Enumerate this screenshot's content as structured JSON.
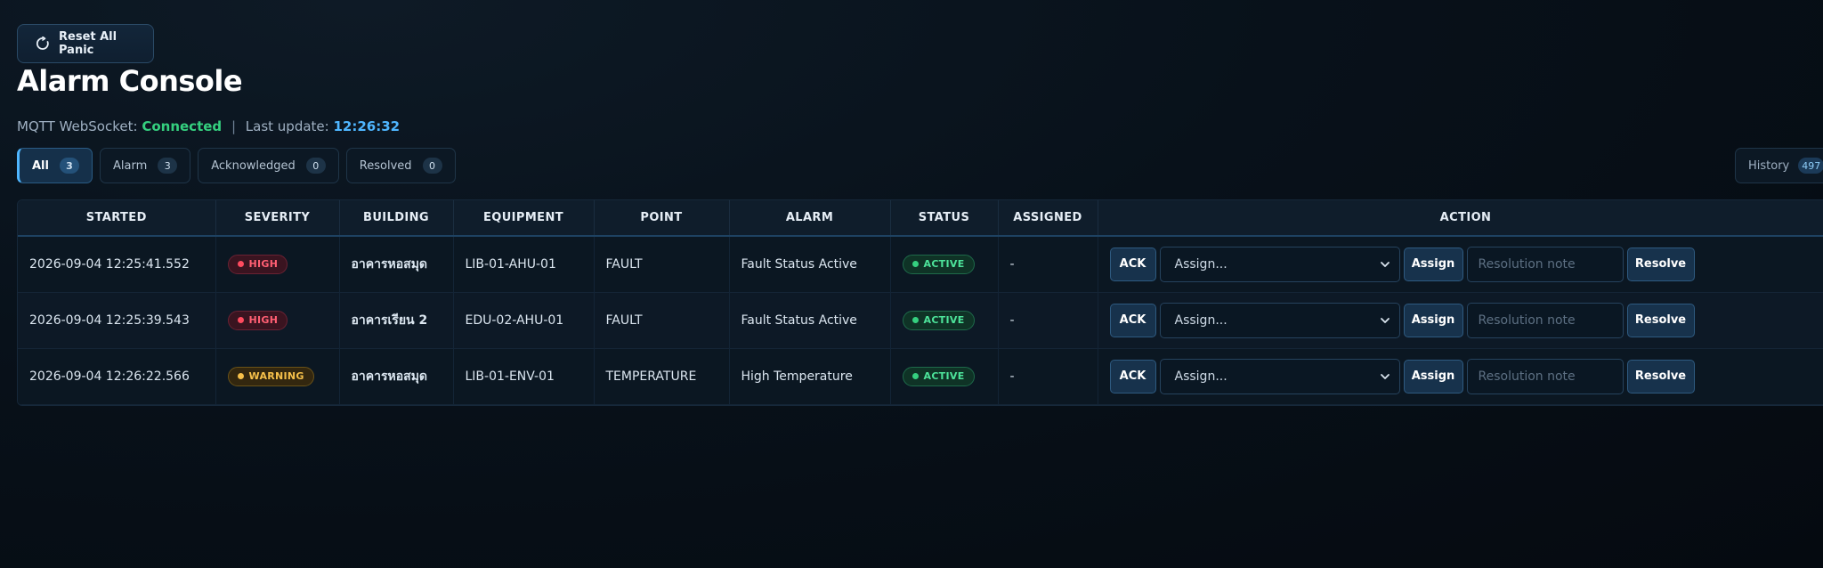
{
  "header": {
    "reset_button": "Reset All Panic",
    "title": "Alarm Console"
  },
  "status": {
    "prefix": "MQTT WebSocket:",
    "connection": "Connected",
    "separator": "|",
    "last_update_label": "Last update:",
    "last_update": "12:26:32"
  },
  "tabs": [
    {
      "label": "All",
      "count": "3"
    },
    {
      "label": "Alarm",
      "count": "3"
    },
    {
      "label": "Acknowledged",
      "count": "0"
    },
    {
      "label": "Resolved",
      "count": "0"
    }
  ],
  "history": {
    "label": "History",
    "count": "497"
  },
  "table": {
    "columns": [
      "STARTED",
      "SEVERITY",
      "BUILDING",
      "EQUIPMENT",
      "POINT",
      "ALARM",
      "STATUS",
      "ASSIGNED",
      "ACTION"
    ],
    "rows": [
      {
        "started": "2026-09-04 12:25:41.552",
        "severity": "HIGH",
        "building": "อาคารหอสมุด",
        "equipment": "LIB-01-AHU-01",
        "point": "FAULT",
        "alarm": "Fault Status Active",
        "status": "ACTIVE",
        "assigned": "-"
      },
      {
        "started": "2026-09-04 12:25:39.543",
        "severity": "HIGH",
        "building": "อาคารเรียน 2",
        "equipment": "EDU-02-AHU-01",
        "point": "FAULT",
        "alarm": "Fault Status Active",
        "status": "ACTIVE",
        "assigned": "-"
      },
      {
        "started": "2026-09-04 12:26:22.566",
        "severity": "WARNING",
        "building": "อาคารหอสมุด",
        "equipment": "LIB-01-ENV-01",
        "point": "TEMPERATURE",
        "alarm": "High Temperature",
        "status": "ACTIVE",
        "assigned": "-"
      }
    ]
  },
  "actions": {
    "ack": "ACK",
    "assign_select": "Assign...",
    "assign": "Assign",
    "note_placeholder": "Resolution note",
    "resolve": "Resolve"
  },
  "colors": {
    "accent": "#4fb6ff",
    "connected": "#35d07f",
    "high": "#ff4b5f",
    "warning": "#f6c04a",
    "active": "#35d07f"
  },
  "icons": {
    "reset": "reset-icon",
    "select": "chevron-down-icon"
  }
}
